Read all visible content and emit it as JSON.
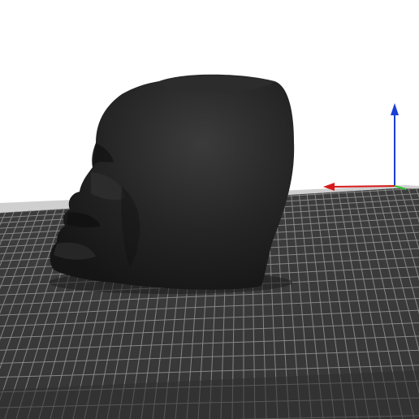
{
  "viewport": {
    "background_color": "#ffffff",
    "bed_color": "#3a3a3a",
    "bed_grid_color": "#9a9a9a",
    "bed_edge_color": "#cfcfcf",
    "model_color": "#1e1e1e",
    "model_highlight_color": "#3a3a3a"
  },
  "axes": {
    "z_axis_color": "#1a3fd6",
    "x_axis_color": "#d61a1a",
    "y_axis_color": "#2ec22e",
    "z_icon": "arrow-up-icon",
    "x_icon": "arrow-left-icon"
  },
  "model": {
    "icon": "head-model"
  }
}
